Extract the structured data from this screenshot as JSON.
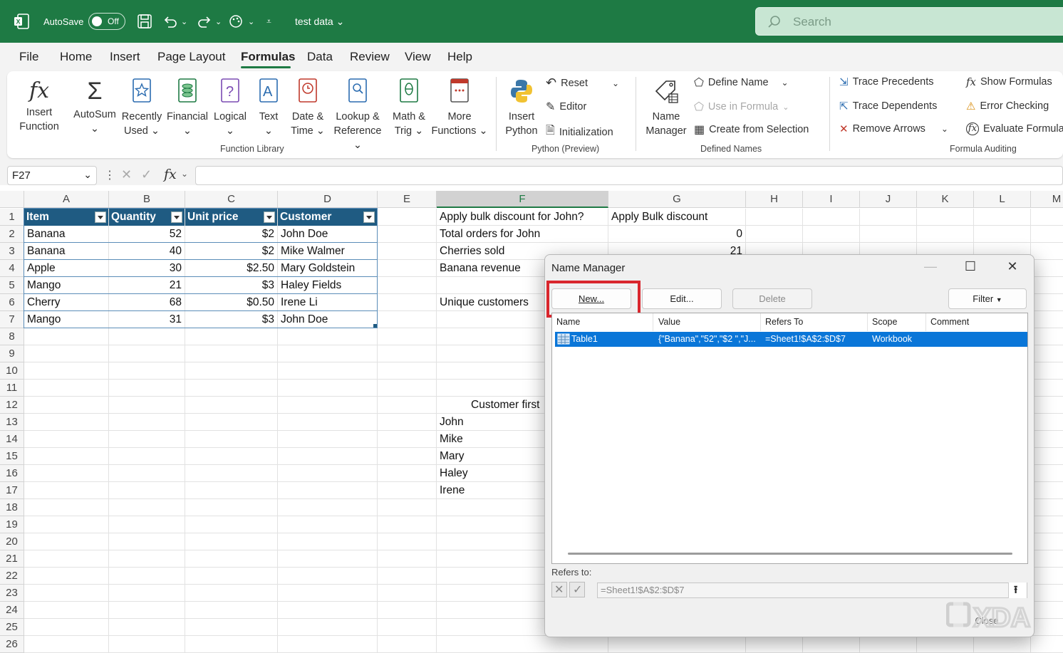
{
  "titlebar": {
    "autosave_label": "AutoSave",
    "autosave_state": "Off",
    "filename": "test data",
    "search_placeholder": "Search"
  },
  "tabs": [
    {
      "label": "File"
    },
    {
      "label": "Home"
    },
    {
      "label": "Insert"
    },
    {
      "label": "Page Layout"
    },
    {
      "label": "Formulas"
    },
    {
      "label": "Data"
    },
    {
      "label": "Review"
    },
    {
      "label": "View"
    },
    {
      "label": "Help"
    }
  ],
  "active_tab": "Formulas",
  "ribbon": {
    "function_library": {
      "group_label": "Function Library",
      "insert_function": [
        "Insert",
        "Function"
      ],
      "autosum": [
        "AutoSum"
      ],
      "recently_used": [
        "Recently",
        "Used"
      ],
      "financial": [
        "Financial"
      ],
      "logical": [
        "Logical"
      ],
      "text": [
        "Text"
      ],
      "date_time": [
        "Date &",
        "Time"
      ],
      "lookup": [
        "Lookup &",
        "Reference"
      ],
      "math": [
        "Math &",
        "Trig"
      ],
      "more": [
        "More",
        "Functions"
      ]
    },
    "python": {
      "group_label": "Python (Preview)",
      "insert_python": [
        "Insert",
        "Python"
      ],
      "reset": "Reset",
      "editor": "Editor",
      "initialization": "Initialization"
    },
    "defined_names": {
      "group_label": "Defined Names",
      "name_manager": [
        "Name",
        "Manager"
      ],
      "define_name": "Define Name",
      "use_in_formula": "Use in Formula",
      "create_from_selection": "Create from Selection"
    },
    "formula_auditing": {
      "group_label": "Formula Auditing",
      "trace_precedents": "Trace Precedents",
      "trace_dependents": "Trace Dependents",
      "remove_arrows": "Remove Arrows",
      "show_formulas": "Show Formulas",
      "error_checking": "Error Checking",
      "evaluate_formula": "Evaluate Formula"
    }
  },
  "formula_bar": {
    "name_box": "F27",
    "formula": ""
  },
  "columns": [
    "A",
    "B",
    "C",
    "D",
    "E",
    "F",
    "G",
    "H",
    "I",
    "J",
    "K",
    "L",
    "M"
  ],
  "rows": [
    "1",
    "2",
    "3",
    "4",
    "5",
    "6",
    "7",
    "8",
    "9",
    "10",
    "11",
    "12",
    "13",
    "14",
    "15",
    "16",
    "17",
    "18",
    "19",
    "20",
    "21",
    "22",
    "23",
    "24",
    "25",
    "26"
  ],
  "table": {
    "headers": [
      "Item",
      "Quantity",
      "Unit price",
      "Customer"
    ],
    "rows": [
      [
        "Banana",
        "52",
        "$2",
        "John Doe"
      ],
      [
        "Banana",
        "40",
        "$2",
        "Mike Walmer"
      ],
      [
        "Apple",
        "30",
        "$2.50",
        "Mary Goldstein"
      ],
      [
        "Mango",
        "21",
        "$3",
        "Haley Fields"
      ],
      [
        "Cherry",
        "68",
        "$0.50",
        "Irene Li"
      ],
      [
        "Mango",
        "31",
        "$3",
        "John Doe"
      ]
    ]
  },
  "sheet_cells": {
    "f1": "Apply bulk discount for John?",
    "g1": "Apply Bulk discount",
    "f2": "Total orders for John",
    "g2": "0",
    "f3": "Cherries sold",
    "g3": "21",
    "f4": "Banana revenue",
    "f6": "Unique customers",
    "f12": "Customer first",
    "f13": "John",
    "f14": "Mike",
    "f15": "Mary",
    "f16": "Haley",
    "f17": "Irene"
  },
  "dialog": {
    "title": "Name Manager",
    "new_btn": "New...",
    "edit_btn": "Edit...",
    "delete_btn": "Delete",
    "filter_btn": "Filter",
    "columns": [
      "Name",
      "Value",
      "Refers To",
      "Scope",
      "Comment"
    ],
    "entry": {
      "name": "Table1",
      "value": "{\"Banana\",\"52\",\"$2 \",\"J...",
      "refers_to": "=Sheet1!$A$2:$D$7",
      "scope": "Workbook",
      "comment": ""
    },
    "refers_label": "Refers to:",
    "refers_value": "=Sheet1!$A$2:$D$7",
    "close_btn": "Close"
  },
  "watermark": "XDA",
  "colors": {
    "excel_green": "#1e7a44",
    "table_header": "#1f5b82",
    "selection": "#0a76d8",
    "highlight": "#d9262d"
  }
}
